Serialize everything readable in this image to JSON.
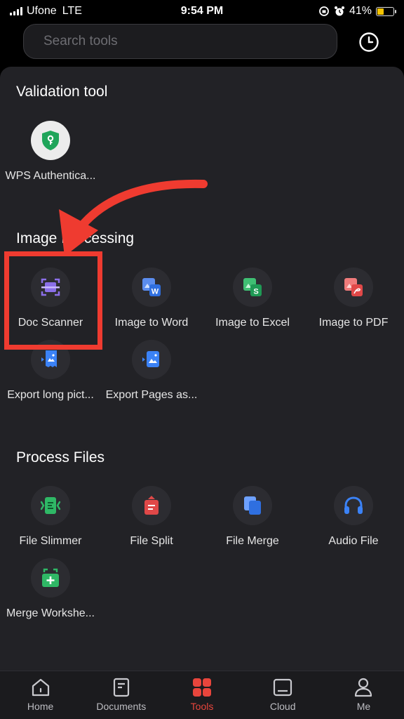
{
  "status_bar": {
    "carrier": "Ufone",
    "network": "LTE",
    "time": "9:54 PM",
    "battery": "41%",
    "battery_level": 0.41
  },
  "search": {
    "placeholder": "Search tools"
  },
  "sections": {
    "validation": {
      "title": "Validation tool",
      "tools": [
        {
          "label": "WPS Authentica...",
          "icon": "shield-key-icon"
        }
      ]
    },
    "image_processing": {
      "title": "Image Processing",
      "tools": [
        {
          "label": "Doc Scanner",
          "icon": "doc-scanner-icon"
        },
        {
          "label": "Image to Word",
          "icon": "image-to-word-icon"
        },
        {
          "label": "Image to Excel",
          "icon": "image-to-excel-icon"
        },
        {
          "label": "Image to PDF",
          "icon": "image-to-pdf-icon"
        },
        {
          "label": "Export long pict...",
          "icon": "export-long-picture-icon"
        },
        {
          "label": "Export Pages as...",
          "icon": "export-pages-icon"
        }
      ]
    },
    "process_files": {
      "title": "Process Files",
      "tools": [
        {
          "label": "File Slimmer",
          "icon": "file-slimmer-icon"
        },
        {
          "label": "File Split",
          "icon": "file-split-icon"
        },
        {
          "label": "File Merge",
          "icon": "file-merge-icon"
        },
        {
          "label": "Audio File",
          "icon": "headphones-icon"
        },
        {
          "label": "Merge Workshe...",
          "icon": "merge-worksheets-icon"
        }
      ]
    }
  },
  "tabs": [
    {
      "label": "Home",
      "icon": "home-icon"
    },
    {
      "label": "Documents",
      "icon": "documents-icon"
    },
    {
      "label": "Tools",
      "icon": "tools-icon",
      "active": true
    },
    {
      "label": "Cloud",
      "icon": "cloud-icon"
    },
    {
      "label": "Me",
      "icon": "user-icon"
    }
  ],
  "colors": {
    "accent": "#e8453c",
    "annotation": "#ef3b30",
    "panel": "#222226"
  }
}
